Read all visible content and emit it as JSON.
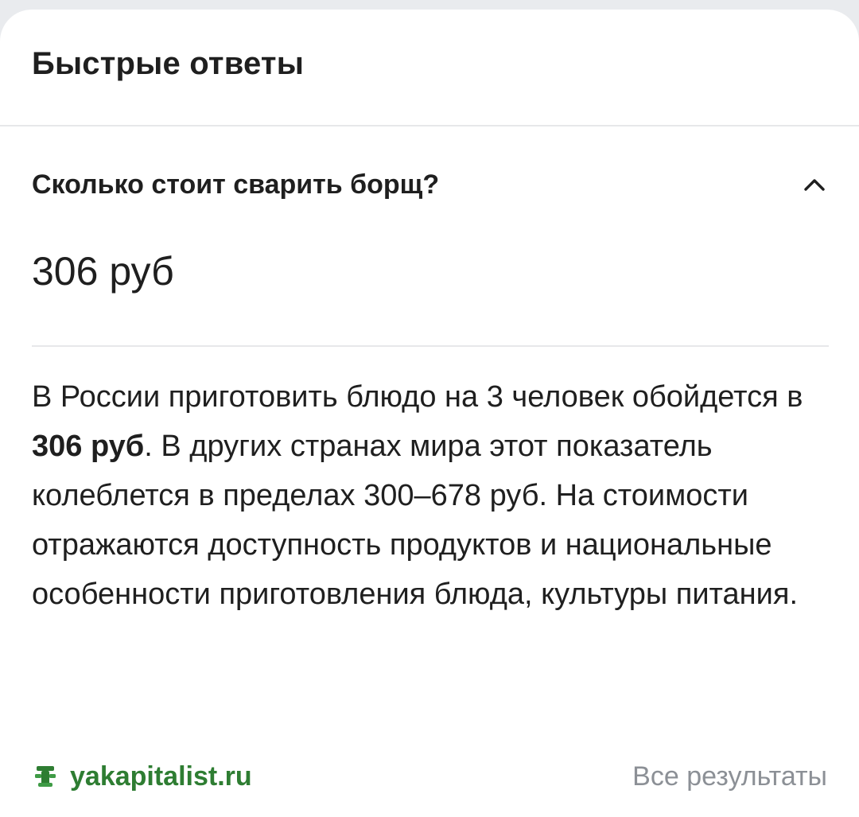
{
  "header": {
    "title": "Быстрые ответы"
  },
  "question": {
    "text": "Сколько стоит сварить борщ?",
    "expand_icon": "chevron-up-icon"
  },
  "answer": {
    "value": "306 руб",
    "body_part1": "В России приготовить блюдо на 3 человек обойдется в ",
    "body_bold": "306 руб",
    "body_part2": ". В других странах мира этот показатель колеблется в пределах 300–678 руб. На стоимости отражаются доступность продуктов и национальные особенности приготовления блюда, культуры питания."
  },
  "footer": {
    "source_icon": "site-favicon-icon",
    "source_label": "yakapitalist.ru",
    "all_results_label": "Все результаты"
  },
  "colors": {
    "background": "#e9ebee",
    "card": "#ffffff",
    "text": "#1f1f1f",
    "source_green": "#2e7d32",
    "muted": "#8c9096",
    "divider": "#e7e8ea"
  }
}
